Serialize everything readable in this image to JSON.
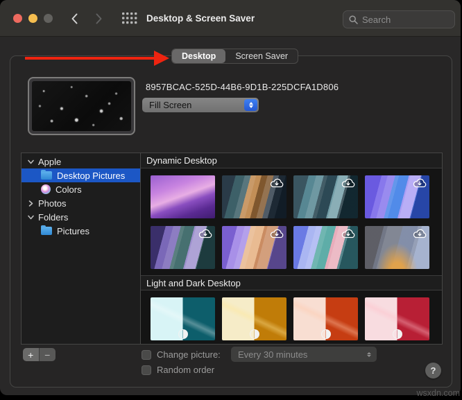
{
  "window": {
    "title": "Desktop & Screen Saver"
  },
  "titlebar": {
    "search_placeholder": "Search"
  },
  "tabs": [
    {
      "label": "Desktop",
      "selected": true
    },
    {
      "label": "Screen Saver",
      "selected": false
    }
  ],
  "preview": {
    "name": "8957BCAC-525D-44B6-9D1B-225DCFA1D806",
    "fill_mode": "Fill Screen"
  },
  "sidebar": {
    "items": [
      {
        "label": "Apple",
        "type": "group",
        "expanded": true
      },
      {
        "label": "Desktop Pictures",
        "type": "folder",
        "selected": true
      },
      {
        "label": "Colors",
        "type": "colors",
        "selected": false
      },
      {
        "label": "Photos",
        "type": "group",
        "expanded": false
      },
      {
        "label": "Folders",
        "type": "group",
        "expanded": true
      },
      {
        "label": "Pictures",
        "type": "folder",
        "selected": false
      }
    ]
  },
  "sections": [
    {
      "title": "Dynamic Desktop"
    },
    {
      "title": "Light and Dark Desktop"
    }
  ],
  "thumbs": {
    "items": [
      {
        "downloadable": false,
        "bg": "linear-gradient(160deg, #9a5fd0 0%, #c884e0 30%, #e8aee4 48%, #8a4ec0 62%, #5a2a92 80%, #3f1c70 100%)"
      },
      {
        "downloadable": true,
        "bg": "linear-gradient(105deg, rgba(255,255,255,0) 0 30%, rgba(255,255,255,0.14) 30% 45%, rgba(255,255,255,0.04) 45% 60%, rgba(255,255,255,0.2) 60% 75%, rgba(0,0,0,0.18) 75% 100%), linear-gradient(105deg, #2a3b48 0 18%, #3d6068 18% 38%, #c08a50 38% 52%, #7a5026 52% 68%, #233240 68% 84%, #15222e 84% 100%)"
      },
      {
        "downloadable": true,
        "bg": "linear-gradient(105deg, rgba(255,255,255,0) 0 30%, rgba(255,255,255,0.14) 30% 45%, rgba(255,255,255,0.04) 45% 60%, rgba(255,255,255,0.2) 60% 75%, rgba(0,0,0,0.18) 75% 100%), linear-gradient(105deg, #3a5560 0 20%, #578793 20% 40%, #24424e 40% 58%, #6d9aa4 58% 72%, #16303a 72% 100%)"
      },
      {
        "downloadable": true,
        "bg": "linear-gradient(105deg, rgba(255,255,255,0) 0 30%, rgba(255,255,255,0.14) 30% 45%, rgba(255,255,255,0.04) 45% 60%, rgba(255,255,255,0.2) 60% 75%, rgba(0,0,0,0.18) 75% 100%), linear-gradient(105deg, #6a5ae0 0 22%, #8878ec 22% 40%, #4a86e8 40% 58%, #a89af4 58% 74%, #2f55cc 74% 100%)"
      },
      {
        "downloadable": true,
        "bg": "linear-gradient(105deg, rgba(255,255,255,0) 0 30%, rgba(255,255,255,0.14) 30% 45%, rgba(255,255,255,0.04) 45% 60%, rgba(255,255,255,0.2) 60% 75%, rgba(0,0,0,0.18) 75% 100%), linear-gradient(105deg, #3a2f6a 0 20%, #7a68b8 20% 40%, #3f6a6a 40% 58%, #9a8ccc 58% 74%, #23484c 74% 100%)"
      },
      {
        "downloadable": true,
        "bg": "linear-gradient(105deg, rgba(255,255,255,0) 0 30%, rgba(255,255,255,0.14) 30% 45%, rgba(255,255,255,0.04) 45% 60%, rgba(255,255,255,0.2) 60% 75%, rgba(0,0,0,0.18) 75% 100%), linear-gradient(105deg, #7a5fd0 0 20%, #a890e8 20% 38%, #e8b88e 38% 56%, #c8875c 56% 74%, #6a55aa 74% 100%)"
      },
      {
        "downloadable": true,
        "bg": "linear-gradient(105deg, rgba(255,255,255,0) 0 30%, rgba(255,255,255,0.14) 30% 45%, rgba(255,255,255,0.04) 45% 60%, rgba(255,255,255,0.2) 60% 75%, rgba(0,0,0,0.18) 75% 100%), linear-gradient(105deg, #6a7ae4 0 20%, #aab6f2 20% 38%, #58aaa4 38% 56%, #e8aab8 56% 72%, #2f6a72 72% 100%)"
      },
      {
        "downloadable": true,
        "bg": "radial-gradient(ellipse at 50% 110%, rgba(240,165,60,0.85) 0 16%, rgba(240,165,60,0) 45%), linear-gradient(105deg, rgba(255,255,255,0.05) 0 30%, rgba(255,255,255,0.16) 30% 50%, rgba(255,255,255,0.04) 50% 70%, rgba(255,255,255,0.18) 70% 100%), linear-gradient(105deg, #55565e 0 25%, #6a7080 25% 50%, #7e8aa6 50% 75%, #93a2c4 75% 100%)"
      },
      {
        "downloadable": false,
        "bg": "linear-gradient(25deg, rgba(255,255,255,0) 42%, rgba(255,255,255,0.3) 50%, rgba(255,255,255,0) 58%), linear-gradient(90deg, #d8f4f6 50%, #0d5e6b 50%)"
      },
      {
        "downloadable": false,
        "bg": "linear-gradient(25deg, rgba(255,255,255,0) 42%, rgba(255,230,150,0.4) 50%, rgba(255,255,255,0) 58%), linear-gradient(90deg, #f6ecc8 50%, #c07c08 50%)"
      },
      {
        "downloadable": false,
        "bg": "linear-gradient(25deg, rgba(255,255,255,0) 42%, rgba(255,200,170,0.4) 50%, rgba(255,255,255,0) 58%), linear-gradient(90deg, #f8ded2 50%, #c63d12 50%)"
      },
      {
        "downloadable": false,
        "bg": "linear-gradient(25deg, rgba(255,255,255,0) 42%, rgba(255,190,200,0.4) 50%, rgba(255,255,255,0) 58%), linear-gradient(90deg, #f8dce0 50%, #b81f35 50%)"
      }
    ]
  },
  "footer": {
    "add_label": "+",
    "remove_label": "−",
    "change_picture_label": "Change picture:",
    "interval": "Every 30 minutes",
    "random_order_label": "Random order",
    "help_label": "?"
  },
  "watermark": "wsxdn.com",
  "colors": {
    "selection_blue": "#1c57c5",
    "popup_accent_blue": "#2c63dd",
    "annotation_arrow_red": "#ee2410",
    "traffic_red": "#ee6a5f",
    "traffic_yellow": "#f5bd4f",
    "traffic_gray": "#62615e"
  }
}
